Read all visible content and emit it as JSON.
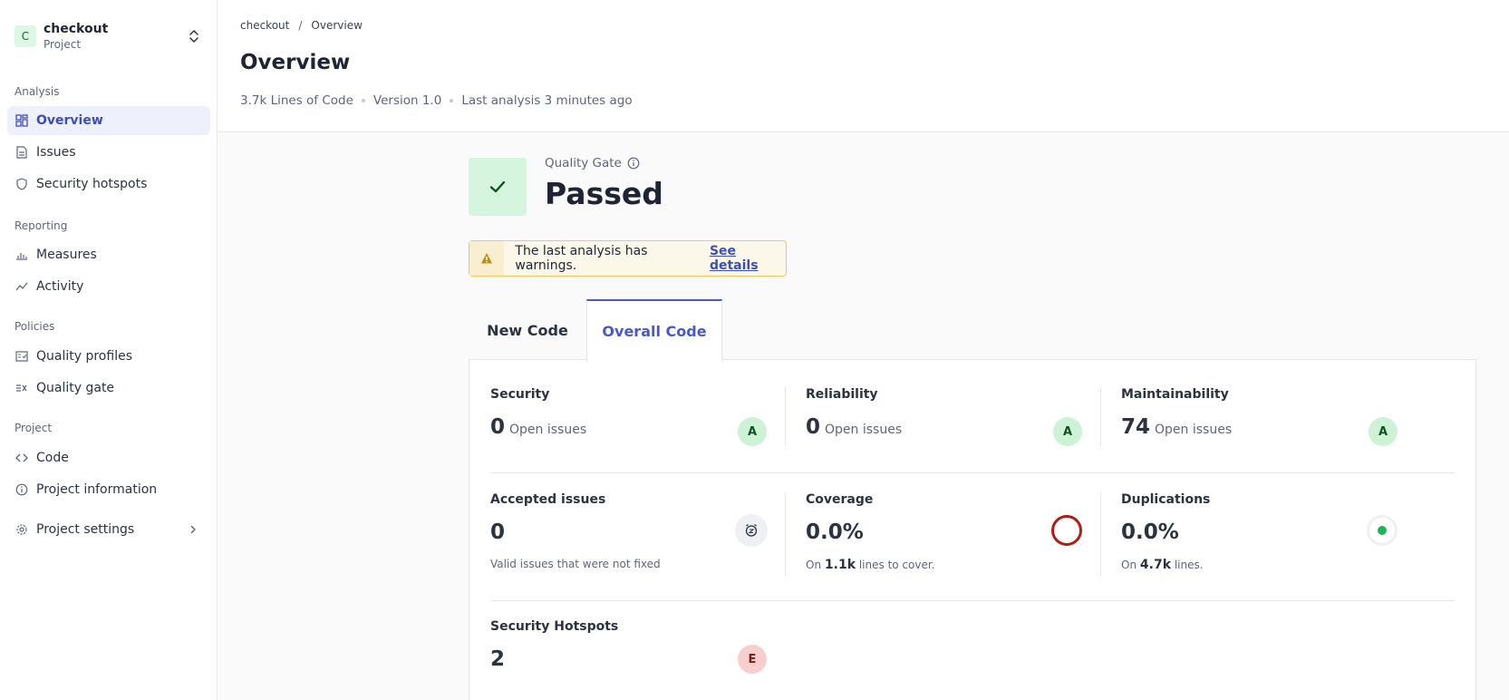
{
  "project": {
    "avatar_letter": "C",
    "name": "checkout",
    "subtitle": "Project"
  },
  "sidebar": {
    "sections": {
      "analysis": "Analysis",
      "reporting": "Reporting",
      "policies": "Policies",
      "project": "Project"
    },
    "items": {
      "overview": "Overview",
      "issues": "Issues",
      "security_hotspots": "Security hotspots",
      "measures": "Measures",
      "activity": "Activity",
      "quality_profiles": "Quality profiles",
      "quality_gate": "Quality gate",
      "code": "Code",
      "project_information": "Project information",
      "project_settings": "Project settings"
    },
    "active": "overview"
  },
  "header": {
    "breadcrumb": {
      "project": "checkout",
      "separator": "/",
      "current": "Overview"
    },
    "title": "Overview",
    "meta": {
      "loc": "3.7k Lines of Code",
      "version": "Version 1.0",
      "last_analysis": "Last analysis 3 minutes ago"
    }
  },
  "quality_gate": {
    "label": "Quality Gate",
    "status": "Passed",
    "status_color": "#d6f5de"
  },
  "warning": {
    "text": "The last analysis has warnings.",
    "link": "See details"
  },
  "tabs": {
    "new_code": "New Code",
    "overall_code": "Overall Code",
    "selected": "overall_code"
  },
  "metrics": {
    "security": {
      "title": "Security",
      "value": "0",
      "unit": "Open issues",
      "grade": "A"
    },
    "reliability": {
      "title": "Reliability",
      "value": "0",
      "unit": "Open issues",
      "grade": "A"
    },
    "maintainability": {
      "title": "Maintainability",
      "value": "74",
      "unit": "Open issues",
      "grade": "A"
    },
    "accepted": {
      "title": "Accepted issues",
      "value": "0",
      "footer": "Valid issues that were not fixed",
      "icon": "accepted-clock-icon"
    },
    "coverage": {
      "title": "Coverage",
      "value": "0.0%",
      "footer_pre": "On",
      "footer_num": "1.1k",
      "footer_post": "lines to cover.",
      "ring_color": "#b01d12"
    },
    "duplications": {
      "title": "Duplications",
      "value": "0.0%",
      "footer_pre": "On",
      "footer_num": "4.7k",
      "footer_post": "lines.",
      "dot_color": "#1db35a"
    },
    "hotspots": {
      "title": "Security Hotspots",
      "value": "2",
      "grade": "E"
    }
  },
  "colors": {
    "accent": "#4a5ac4",
    "grade_a_bg": "#cdf2d5",
    "grade_e_bg": "#f8cfcd",
    "warning_border": "#f3c757"
  }
}
